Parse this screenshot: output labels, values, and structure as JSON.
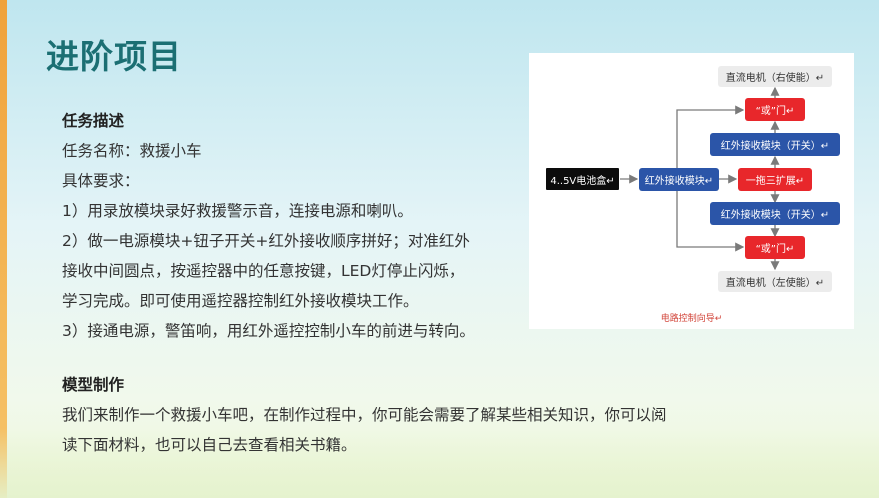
{
  "title": "进阶项目",
  "task": {
    "heading": "任务描述",
    "name_line": "任务名称：救援小车",
    "req_heading": "具体要求：",
    "req1": "1）用录放模块录好救援警示音，连接电源和喇叭。",
    "req2_line1": "2）做一电源模块+钮子开关+红外接收顺序拼好；对准红外",
    "req2_line2": "接收中间圆点，按遥控器中的任意按键，LED灯停止闪烁，",
    "req2_line3": "学习完成。即可使用遥控器控制红外接收模块工作。",
    "req3": "3）接通电源，警笛响，用红外遥控控制小车的前进与转向。"
  },
  "model": {
    "heading": "模型制作",
    "line1": "我们来制作一个救援小车吧，在制作过程中，你可能会需要了解某些相关知识，你可以阅",
    "line2": "读下面材料，也可以自己去查看相关书籍。"
  },
  "diagram": {
    "motor_right": "直流电机（右使能）↵",
    "or_top": "“或”门↵",
    "ir_switch_top": "红外接收模块（开关）↵",
    "battery": "4..5V电池盒↵",
    "ir_receiver": "红外接收模块↵",
    "splitter": "一拖三扩展↵",
    "ir_switch_bottom": "红外接收模块（开关）↵",
    "or_bottom": "“或”门↵",
    "motor_left": "直流电机（左使能）↵",
    "caption": "电路控制向导↵",
    "colors": {
      "blue": "#2b55a8",
      "red": "#e8272b",
      "gray": "#ececec",
      "black": "#0c0c0c",
      "arrow": "#7a7a7a"
    }
  }
}
